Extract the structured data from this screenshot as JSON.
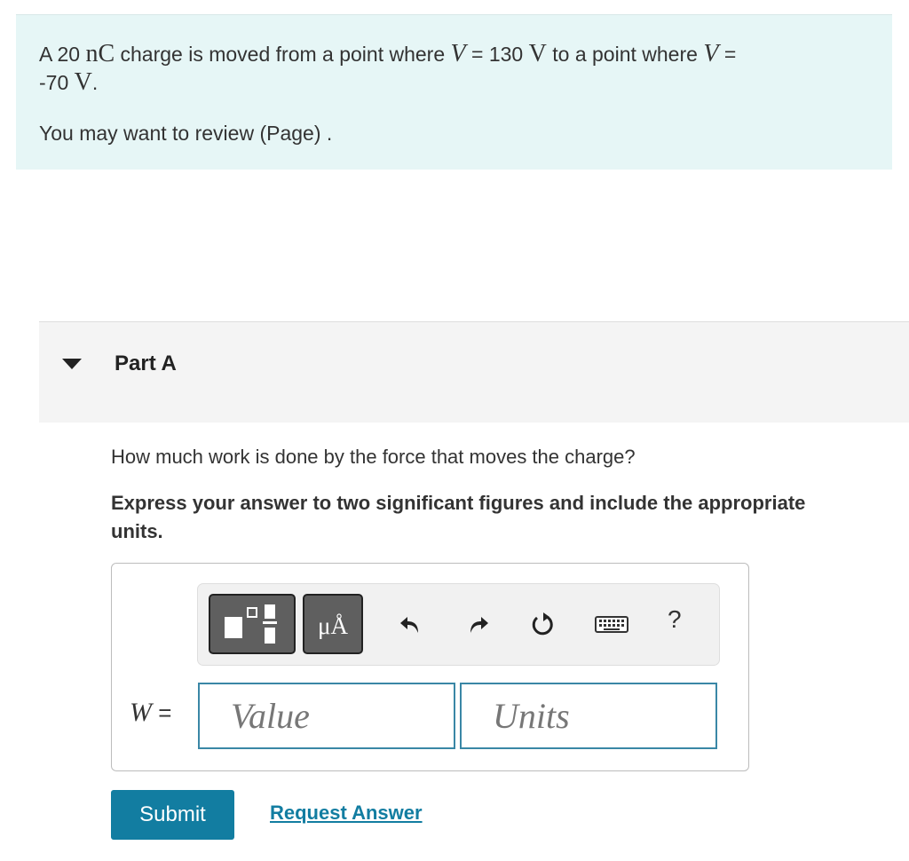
{
  "problem": {
    "line1_pre": "A 20",
    "charge_unit": "nC",
    "line1_mid": "charge is moved from a point where",
    "var_v1": "V",
    "eq1": "= 130",
    "volt_unit1": "V",
    "line1_post": "to a point where",
    "var_v2": "V",
    "eq2": "=",
    "line2_value": "-70",
    "volt_unit2": "V",
    "line2_end": ".",
    "review_text": "You may want to review (Page) ."
  },
  "part": {
    "title": "Part A",
    "question": "How much work is done by the force that moves the charge?",
    "instruction": "Express your answer to two significant figures and include the appropriate units."
  },
  "toolbar": {
    "units_label": "μÅ",
    "help_label": "?",
    "icons": [
      "templates-icon",
      "units-icon",
      "undo-icon",
      "redo-icon",
      "reset-icon",
      "keyboard-icon",
      "help-icon"
    ]
  },
  "answer": {
    "variable": "W",
    "equals": "=",
    "value_placeholder": "Value",
    "units_placeholder": "Units"
  },
  "actions": {
    "submit_label": "Submit",
    "request_label": "Request Answer"
  },
  "colors": {
    "problem_bg": "#e6f6f6",
    "accent": "#127da1",
    "input_border": "#3a87a6"
  }
}
